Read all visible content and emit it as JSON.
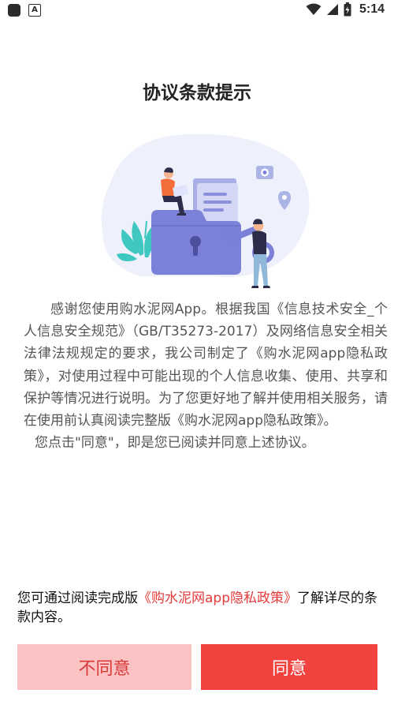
{
  "status_bar": {
    "time": "5:14",
    "icons": [
      "app-icon",
      "a-icon",
      "wifi-icon",
      "cell-signal-icon",
      "battery-icon"
    ]
  },
  "dialog": {
    "title": "协议条款提示",
    "intro": "感谢您使用购水泥网App。根据我国《信息技术安全_个人信息安全规范》（GB/T35273-2017）及网络信息安全相关法律法规规定的要求，我公司制定了《购水泥网app隐私政策》，对使用过程中可能出现的个人信息收集、使用、共享和保护等情况进行说明。为了您更好地了解并使用相关服务，请在使用前认真阅读完整版《购水泥网app隐私政策》。",
    "consent": "您点击\"同意\"，即是您已阅读并同意上述协议。",
    "notice_prefix": "您可通过阅读完成版",
    "notice_link": "《购水泥网app隐私政策》",
    "notice_suffix": "了解详尽的条款内容。",
    "disagree_label": "不同意",
    "agree_label": "同意"
  },
  "colors": {
    "accent": "#f2423f",
    "accent_light": "#fbc3c3",
    "link": "#e43b3b",
    "illustration_primary": "#7b80d8",
    "illustration_bg": "#eef0fb"
  }
}
